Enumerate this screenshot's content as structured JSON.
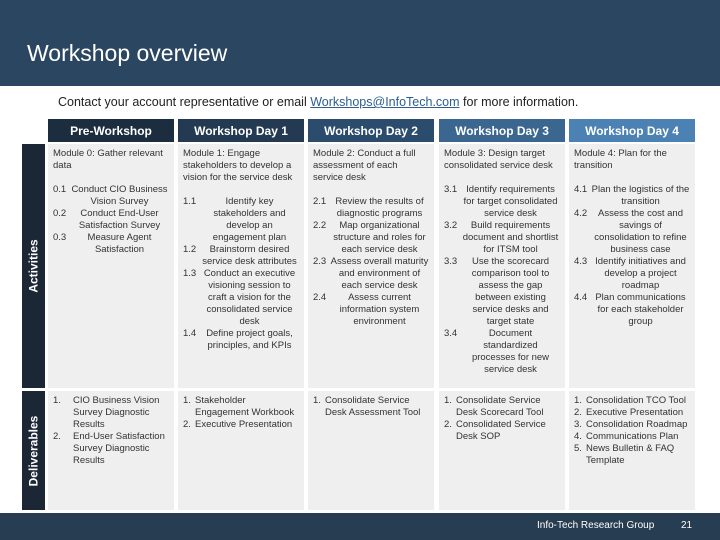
{
  "header": {
    "title": "Workshop overview"
  },
  "contact": {
    "prefix": "Contact your account representative or email ",
    "email": "Workshops@InfoTech.com",
    "suffix": " for more information."
  },
  "columns": [
    {
      "label": "Pre-Workshop",
      "color": "#1c2d40"
    },
    {
      "label": "Workshop Day 1",
      "color": "#233a52"
    },
    {
      "label": "Workshop Day 2",
      "color": "#2b4c6c"
    },
    {
      "label": "Workshop Day 3",
      "color": "#3a6690"
    },
    {
      "label": "Workshop Day 4",
      "color": "#4c82b3"
    }
  ],
  "rows": {
    "activities_label": "Activities",
    "deliverables_label": "Deliverables"
  },
  "activities": [
    {
      "module": "Module 0: Gather relevant data",
      "items": [
        {
          "num": "0.1",
          "text": "Conduct CIO Business Vision Survey"
        },
        {
          "num": "0.2",
          "text": "Conduct End-User Satisfaction Survey"
        },
        {
          "num": "0.3",
          "text": "Measure Agent Satisfaction"
        }
      ]
    },
    {
      "module": "Module 1: Engage stakeholders to develop a vision for the service desk",
      "items": [
        {
          "num": "1.1",
          "text": "Identify key stakeholders and develop an engagement plan"
        },
        {
          "num": "1.2",
          "text": "Brainstorm desired service desk attributes"
        },
        {
          "num": "1.3",
          "text": "Conduct an executive visioning session to craft a vision for the consolidated service desk"
        },
        {
          "num": "1.4",
          "text": "Define project goals, principles, and KPIs"
        }
      ]
    },
    {
      "module": "Module 2: Conduct a full assessment of each service desk",
      "items": [
        {
          "num": "2.1",
          "text": "Review the results of diagnostic programs"
        },
        {
          "num": "2.2",
          "text": "Map organizational structure and roles for each service desk"
        },
        {
          "num": "2.3",
          "text": "Assess overall maturity and environment of each service desk"
        },
        {
          "num": "2.4",
          "text": "Assess current information system environment"
        }
      ]
    },
    {
      "module": "Module 3: Design target consolidated service desk",
      "items": [
        {
          "num": "3.1",
          "text": "Identify requirements for target consolidated service desk"
        },
        {
          "num": "3.2",
          "text": "Build requirements document and shortlist for ITSM tool"
        },
        {
          "num": "3.3",
          "text": "Use the scorecard comparison tool to assess the gap between existing service desks and target state"
        },
        {
          "num": "3.4",
          "text": "Document standardized processes for new service desk"
        }
      ]
    },
    {
      "module": "Module 4: Plan for the transition",
      "items": [
        {
          "num": "4.1",
          "text": "Plan the logistics of the transition"
        },
        {
          "num": "4.2",
          "text": "Assess the cost and savings of consolidation to refine business case"
        },
        {
          "num": "4.3",
          "text": "Identify initiatives and develop a project roadmap"
        },
        {
          "num": "4.4",
          "text": "Plan communications for each stakeholder group"
        }
      ]
    }
  ],
  "deliverables": [
    [
      {
        "num": "1.",
        "text": "CIO Business Vision Survey Diagnostic Results"
      },
      {
        "num": "2.",
        "text": "End-User Satisfaction Survey Diagnostic Results"
      }
    ],
    [
      {
        "num": "1.",
        "text": "Stakeholder Engagement Workbook"
      },
      {
        "num": "2.",
        "text": "Executive Presentation"
      }
    ],
    [
      {
        "num": "1.",
        "text": "Consolidate Service Desk Assessment Tool"
      }
    ],
    [
      {
        "num": "1.",
        "text": "Consolidate Service Desk Scorecard Tool"
      },
      {
        "num": "2.",
        "text": "Consolidated Service Desk SOP"
      }
    ],
    [
      {
        "num": "1.",
        "text": "Consolidation TCO Tool"
      },
      {
        "num": "2.",
        "text": "Executive Presentation"
      },
      {
        "num": "3.",
        "text": "Consolidation Roadmap"
      },
      {
        "num": "4.",
        "text": "Communications Plan"
      },
      {
        "num": "5.",
        "text": "News Bulletin & FAQ Template"
      }
    ]
  ],
  "footer": {
    "company": "Info-Tech Research Group",
    "page": "21"
  }
}
